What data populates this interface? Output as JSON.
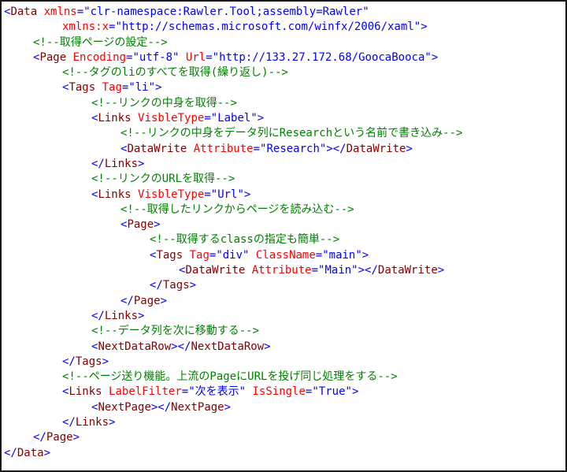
{
  "colors": {
    "tag": "#800000",
    "attr": "#ff0000",
    "value": "#0000ff",
    "punct": "#0000ff",
    "comment": "#008000",
    "background": "#ffffff",
    "border": "#1a1a1a"
  },
  "lines": [
    {
      "indent": 0,
      "tokens": [
        {
          "t": "<",
          "k": "punct"
        },
        {
          "t": "Data",
          "k": "tag"
        },
        {
          "t": " ",
          "k": "text"
        },
        {
          "t": "xmlns",
          "k": "attr"
        },
        {
          "t": "=",
          "k": "punct"
        },
        {
          "t": "\"clr-namespace:Rawler.Tool;assembly=Rawler\"",
          "k": "value"
        }
      ]
    },
    {
      "indent": 2,
      "tokens": [
        {
          "t": "xmlns:x",
          "k": "attr"
        },
        {
          "t": "=",
          "k": "punct"
        },
        {
          "t": "\"http://schemas.microsoft.com/winfx/2006/xaml\"",
          "k": "value"
        },
        {
          "t": ">",
          "k": "punct"
        }
      ]
    },
    {
      "indent": 1,
      "tokens": [
        {
          "t": "<!--取得ページの設定-->",
          "k": "comment"
        }
      ]
    },
    {
      "indent": 1,
      "tokens": [
        {
          "t": "<",
          "k": "punct"
        },
        {
          "t": "Page",
          "k": "tag"
        },
        {
          "t": " ",
          "k": "text"
        },
        {
          "t": "Encoding",
          "k": "attr"
        },
        {
          "t": "=",
          "k": "punct"
        },
        {
          "t": "\"utf-8\"",
          "k": "value"
        },
        {
          "t": " ",
          "k": "text"
        },
        {
          "t": "Url",
          "k": "attr"
        },
        {
          "t": "=",
          "k": "punct"
        },
        {
          "t": "\"http://133.27.172.68/GoocaBooca\"",
          "k": "value"
        },
        {
          "t": ">",
          "k": "punct"
        }
      ]
    },
    {
      "indent": 2,
      "tokens": [
        {
          "t": "<!--タグのliのすべてを取得(繰り返し)-->",
          "k": "comment"
        }
      ]
    },
    {
      "indent": 2,
      "tokens": [
        {
          "t": "<",
          "k": "punct"
        },
        {
          "t": "Tags",
          "k": "tag"
        },
        {
          "t": " ",
          "k": "text"
        },
        {
          "t": "Tag",
          "k": "attr"
        },
        {
          "t": "=",
          "k": "punct"
        },
        {
          "t": "\"li\"",
          "k": "value"
        },
        {
          "t": ">",
          "k": "punct"
        }
      ]
    },
    {
      "indent": 3,
      "tokens": [
        {
          "t": "<!--リンクの中身を取得-->",
          "k": "comment"
        }
      ]
    },
    {
      "indent": 3,
      "tokens": [
        {
          "t": "<",
          "k": "punct"
        },
        {
          "t": "Links",
          "k": "tag"
        },
        {
          "t": " ",
          "k": "text"
        },
        {
          "t": "VisbleType",
          "k": "attr"
        },
        {
          "t": "=",
          "k": "punct"
        },
        {
          "t": "\"Label\"",
          "k": "value"
        },
        {
          "t": ">",
          "k": "punct"
        }
      ]
    },
    {
      "indent": 4,
      "tokens": [
        {
          "t": "<!--リンクの中身をデータ列にResearchという名前で書き込み-->",
          "k": "comment"
        }
      ]
    },
    {
      "indent": 4,
      "tokens": [
        {
          "t": "<",
          "k": "punct"
        },
        {
          "t": "DataWrite",
          "k": "tag"
        },
        {
          "t": " ",
          "k": "text"
        },
        {
          "t": "Attribute",
          "k": "attr"
        },
        {
          "t": "=",
          "k": "punct"
        },
        {
          "t": "\"Research\"",
          "k": "value"
        },
        {
          "t": "></",
          "k": "punct"
        },
        {
          "t": "DataWrite",
          "k": "tag"
        },
        {
          "t": ">",
          "k": "punct"
        }
      ]
    },
    {
      "indent": 3,
      "tokens": [
        {
          "t": "</",
          "k": "punct"
        },
        {
          "t": "Links",
          "k": "tag"
        },
        {
          "t": ">",
          "k": "punct"
        }
      ]
    },
    {
      "indent": 3,
      "tokens": [
        {
          "t": "<!--リンクのURLを取得-->",
          "k": "comment"
        }
      ]
    },
    {
      "indent": 3,
      "tokens": [
        {
          "t": "<",
          "k": "punct"
        },
        {
          "t": "Links",
          "k": "tag"
        },
        {
          "t": " ",
          "k": "text"
        },
        {
          "t": "VisbleType",
          "k": "attr"
        },
        {
          "t": "=",
          "k": "punct"
        },
        {
          "t": "\"Url\"",
          "k": "value"
        },
        {
          "t": ">",
          "k": "punct"
        }
      ]
    },
    {
      "indent": 4,
      "tokens": [
        {
          "t": "<!--取得したリンクからページを読み込む-->",
          "k": "comment"
        }
      ]
    },
    {
      "indent": 4,
      "tokens": [
        {
          "t": "<",
          "k": "punct"
        },
        {
          "t": "Page",
          "k": "tag"
        },
        {
          "t": ">",
          "k": "punct"
        }
      ]
    },
    {
      "indent": 5,
      "tokens": [
        {
          "t": "<!--取得するclassの指定も簡単-->",
          "k": "comment"
        }
      ]
    },
    {
      "indent": 5,
      "tokens": [
        {
          "t": "<",
          "k": "punct"
        },
        {
          "t": "Tags",
          "k": "tag"
        },
        {
          "t": " ",
          "k": "text"
        },
        {
          "t": "Tag",
          "k": "attr"
        },
        {
          "t": "=",
          "k": "punct"
        },
        {
          "t": "\"div\"",
          "k": "value"
        },
        {
          "t": " ",
          "k": "text"
        },
        {
          "t": "ClassName",
          "k": "attr"
        },
        {
          "t": "=",
          "k": "punct"
        },
        {
          "t": "\"main\"",
          "k": "value"
        },
        {
          "t": ">",
          "k": "punct"
        }
      ]
    },
    {
      "indent": 6,
      "tokens": [
        {
          "t": "<",
          "k": "punct"
        },
        {
          "t": "DataWrite",
          "k": "tag"
        },
        {
          "t": " ",
          "k": "text"
        },
        {
          "t": "Attribute",
          "k": "attr"
        },
        {
          "t": "=",
          "k": "punct"
        },
        {
          "t": "\"Main\"",
          "k": "value"
        },
        {
          "t": "></",
          "k": "punct"
        },
        {
          "t": "DataWrite",
          "k": "tag"
        },
        {
          "t": ">",
          "k": "punct"
        }
      ]
    },
    {
      "indent": 5,
      "tokens": [
        {
          "t": "</",
          "k": "punct"
        },
        {
          "t": "Tags",
          "k": "tag"
        },
        {
          "t": ">",
          "k": "punct"
        }
      ]
    },
    {
      "indent": 4,
      "tokens": [
        {
          "t": "</",
          "k": "punct"
        },
        {
          "t": "Page",
          "k": "tag"
        },
        {
          "t": ">",
          "k": "punct"
        }
      ]
    },
    {
      "indent": 3,
      "tokens": [
        {
          "t": "</",
          "k": "punct"
        },
        {
          "t": "Links",
          "k": "tag"
        },
        {
          "t": ">",
          "k": "punct"
        }
      ]
    },
    {
      "indent": 3,
      "tokens": [
        {
          "t": "<!--データ列を次に移動する-->",
          "k": "comment"
        }
      ]
    },
    {
      "indent": 3,
      "tokens": [
        {
          "t": "<",
          "k": "punct"
        },
        {
          "t": "NextDataRow",
          "k": "tag"
        },
        {
          "t": "></",
          "k": "punct"
        },
        {
          "t": "NextDataRow",
          "k": "tag"
        },
        {
          "t": ">",
          "k": "punct"
        }
      ]
    },
    {
      "indent": 2,
      "tokens": [
        {
          "t": "</",
          "k": "punct"
        },
        {
          "t": "Tags",
          "k": "tag"
        },
        {
          "t": ">",
          "k": "punct"
        }
      ]
    },
    {
      "indent": 2,
      "tokens": [
        {
          "t": "<!--ページ送り機能。上流のPageにURLを投げ同じ処理をする-->",
          "k": "comment"
        }
      ]
    },
    {
      "indent": 2,
      "tokens": [
        {
          "t": "<",
          "k": "punct"
        },
        {
          "t": "Links",
          "k": "tag"
        },
        {
          "t": " ",
          "k": "text"
        },
        {
          "t": "LabelFilter",
          "k": "attr"
        },
        {
          "t": "=",
          "k": "punct"
        },
        {
          "t": "\"次を表示\"",
          "k": "value"
        },
        {
          "t": " ",
          "k": "text"
        },
        {
          "t": "IsSingle",
          "k": "attr"
        },
        {
          "t": "=",
          "k": "punct"
        },
        {
          "t": "\"True\"",
          "k": "value"
        },
        {
          "t": ">",
          "k": "punct"
        }
      ]
    },
    {
      "indent": 3,
      "tokens": [
        {
          "t": "<",
          "k": "punct"
        },
        {
          "t": "NextPage",
          "k": "tag"
        },
        {
          "t": "></",
          "k": "punct"
        },
        {
          "t": "NextPage",
          "k": "tag"
        },
        {
          "t": ">",
          "k": "punct"
        }
      ]
    },
    {
      "indent": 2,
      "tokens": [
        {
          "t": "</",
          "k": "punct"
        },
        {
          "t": "Links",
          "k": "tag"
        },
        {
          "t": ">",
          "k": "punct"
        }
      ]
    },
    {
      "indent": 1,
      "tokens": [
        {
          "t": "</",
          "k": "punct"
        },
        {
          "t": "Page",
          "k": "tag"
        },
        {
          "t": ">",
          "k": "punct"
        }
      ]
    },
    {
      "indent": 0,
      "tokens": [
        {
          "t": "</",
          "k": "punct"
        },
        {
          "t": "Data",
          "k": "tag"
        },
        {
          "t": ">",
          "k": "punct"
        }
      ]
    }
  ]
}
